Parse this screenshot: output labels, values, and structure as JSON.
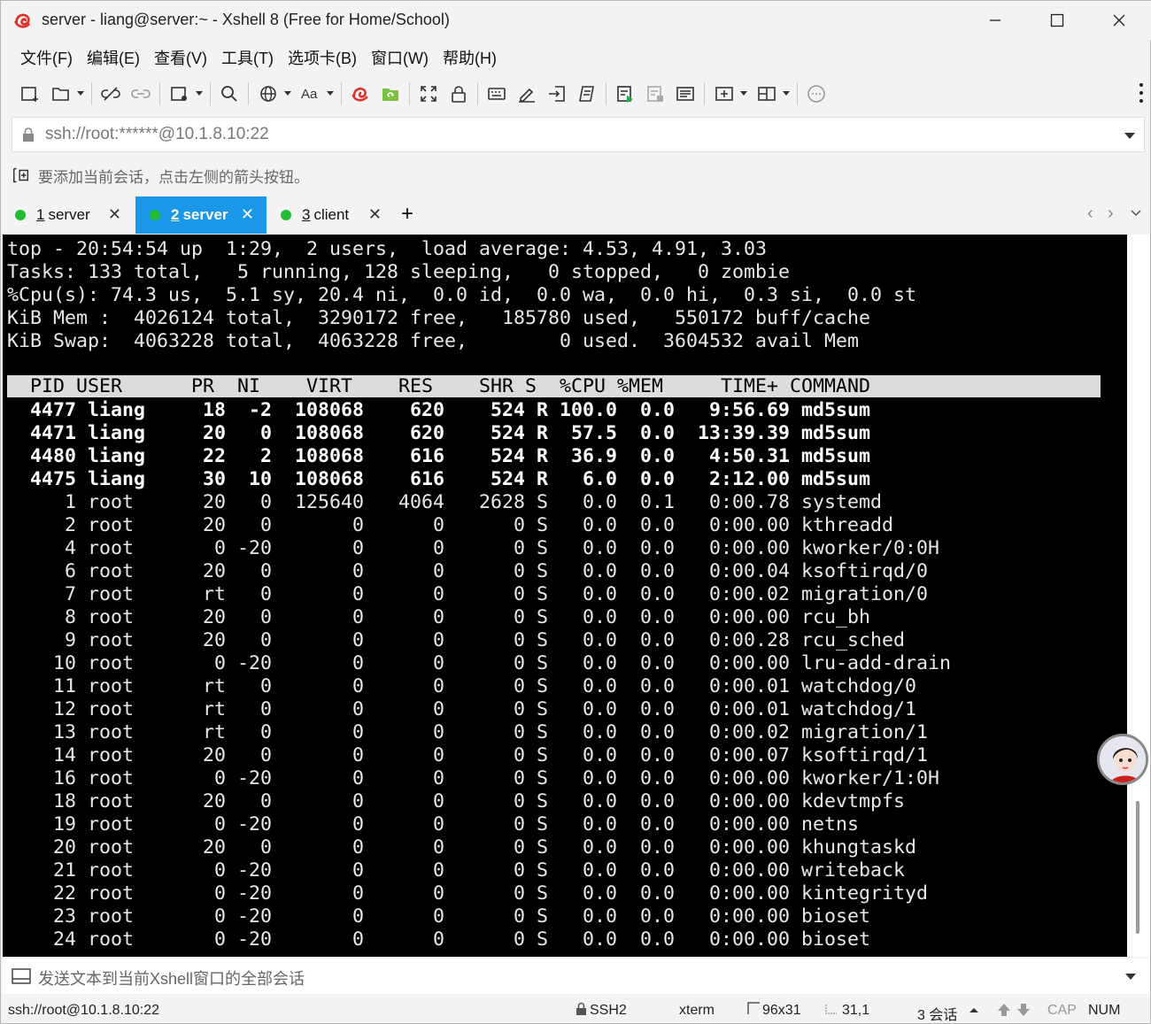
{
  "window": {
    "title": "server - liang@server:~ - Xshell 8 (Free for Home/School)"
  },
  "menu": [
    "文件(F)",
    "编辑(E)",
    "查看(V)",
    "工具(T)",
    "选项卡(B)",
    "窗口(W)",
    "帮助(H)"
  ],
  "address": {
    "url": "ssh://root:******@10.1.8.10:22"
  },
  "hint": {
    "text": "要添加当前会话，点击左侧的箭头按钮。"
  },
  "tabs": [
    {
      "num": "1",
      "label": "server",
      "active": false
    },
    {
      "num": "2",
      "label": "server",
      "active": true
    },
    {
      "num": "3",
      "label": "client",
      "active": false
    }
  ],
  "terminal": {
    "summary": [
      "top - 20:54:54 up  1:29,  2 users,  load average: 4.53, 4.91, 3.03",
      "Tasks: 133 total,   5 running, 128 sleeping,   0 stopped,   0 zombie",
      "%Cpu(s): 74.3 us,  5.1 sy, 20.4 ni,  0.0 id,  0.0 wa,  0.0 hi,  0.3 si,  0.0 st",
      "KiB Mem :  4026124 total,  3290172 free,   185780 used,   550172 buff/cache",
      "KiB Swap:  4063228 total,  4063228 free,        0 used.  3604532 avail Mem"
    ],
    "header": "  PID USER      PR  NI    VIRT    RES    SHR S  %CPU %MEM     TIME+ COMMAND",
    "processes": [
      "4477 liang     18  -2  108068    620    524 R 100.0  0.0   9:56.69 md5sum",
      "4471 liang     20   0  108068    620    524 R  57.5  0.0  13:39.39 md5sum",
      "4480 liang     22   2  108068    616    524 R  36.9  0.0   4:50.31 md5sum",
      "4475 liang     30  10  108068    616    524 R   6.0  0.0   2:12.00 md5sum",
      "   1 root      20   0  125640   4064   2628 S   0.0  0.1   0:00.78 systemd",
      "   2 root      20   0       0      0      0 S   0.0  0.0   0:00.00 kthreadd",
      "   4 root       0 -20       0      0      0 S   0.0  0.0   0:00.00 kworker/0:0H",
      "   6 root      20   0       0      0      0 S   0.0  0.0   0:00.04 ksoftirqd/0",
      "   7 root      rt   0       0      0      0 S   0.0  0.0   0:00.02 migration/0",
      "   8 root      20   0       0      0      0 S   0.0  0.0   0:00.00 rcu_bh",
      "   9 root      20   0       0      0      0 S   0.0  0.0   0:00.28 rcu_sched",
      "  10 root       0 -20       0      0      0 S   0.0  0.0   0:00.00 lru-add-drain",
      "  11 root      rt   0       0      0      0 S   0.0  0.0   0:00.01 watchdog/0",
      "  12 root      rt   0       0      0      0 S   0.0  0.0   0:00.01 watchdog/1",
      "  13 root      rt   0       0      0      0 S   0.0  0.0   0:00.02 migration/1",
      "  14 root      20   0       0      0      0 S   0.0  0.0   0:00.07 ksoftirqd/1",
      "  16 root       0 -20       0      0      0 S   0.0  0.0   0:00.00 kworker/1:0H",
      "  18 root      20   0       0      0      0 S   0.0  0.0   0:00.00 kdevtmpfs",
      "  19 root       0 -20       0      0      0 S   0.0  0.0   0:00.00 netns",
      "  20 root      20   0       0      0      0 S   0.0  0.0   0:00.00 khungtaskd",
      "  21 root       0 -20       0      0      0 S   0.0  0.0   0:00.00 writeback",
      "  22 root       0 -20       0      0      0 S   0.0  0.0   0:00.00 kintegrityd",
      "  23 root       0 -20       0      0      0 S   0.0  0.0   0:00.00 bioset",
      "  24 root       0 -20       0      0      0 S   0.0  0.0   0:00.00 bioset"
    ],
    "bold_rows": 4
  },
  "compose": {
    "placeholder": "发送文本到当前Xshell窗口的全部会话"
  },
  "status": {
    "connection": "ssh://root@10.1.8.10:22",
    "protocol": "SSH2",
    "terminal_type": "xterm",
    "size": "96x31",
    "cursor": "31,1",
    "sessions": "3 会话",
    "cap": "CAP",
    "num": "NUM"
  },
  "colors": {
    "tab_active": "#1a97e8",
    "status_dot": "#22bb33",
    "terminal_bg": "#000000"
  }
}
